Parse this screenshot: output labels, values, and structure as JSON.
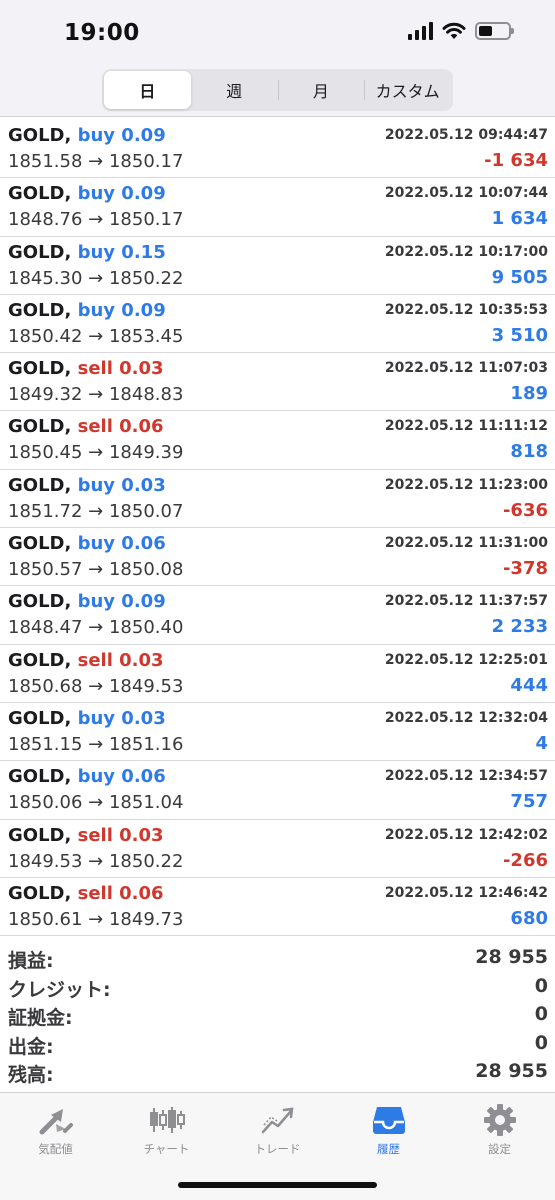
{
  "status_bar": {
    "time": "19:00"
  },
  "segments": [
    {
      "label": "日",
      "active": true
    },
    {
      "label": "週",
      "active": false
    },
    {
      "label": "月",
      "active": false
    },
    {
      "label": "カスタム",
      "active": false
    }
  ],
  "deals": [
    {
      "symbol": "GOLD,",
      "type": "buy",
      "volume": "buy 0.09",
      "prices": "1851.58 → 1850.17",
      "time": "2022.05.12 09:44:47",
      "profit": "-1 634",
      "profit_sign": "neg"
    },
    {
      "symbol": "GOLD,",
      "type": "buy",
      "volume": "buy 0.09",
      "prices": "1848.76 → 1850.17",
      "time": "2022.05.12 10:07:44",
      "profit": "1 634",
      "profit_sign": "pos"
    },
    {
      "symbol": "GOLD,",
      "type": "buy",
      "volume": "buy 0.15",
      "prices": "1845.30 → 1850.22",
      "time": "2022.05.12 10:17:00",
      "profit": "9 505",
      "profit_sign": "pos"
    },
    {
      "symbol": "GOLD,",
      "type": "buy",
      "volume": "buy 0.09",
      "prices": "1850.42 → 1853.45",
      "time": "2022.05.12 10:35:53",
      "profit": "3 510",
      "profit_sign": "pos"
    },
    {
      "symbol": "GOLD,",
      "type": "sell",
      "volume": "sell 0.03",
      "prices": "1849.32 → 1848.83",
      "time": "2022.05.12 11:07:03",
      "profit": "189",
      "profit_sign": "pos"
    },
    {
      "symbol": "GOLD,",
      "type": "sell",
      "volume": "sell 0.06",
      "prices": "1850.45 → 1849.39",
      "time": "2022.05.12 11:11:12",
      "profit": "818",
      "profit_sign": "pos"
    },
    {
      "symbol": "GOLD,",
      "type": "buy",
      "volume": "buy 0.03",
      "prices": "1851.72 → 1850.07",
      "time": "2022.05.12 11:23:00",
      "profit": "-636",
      "profit_sign": "neg"
    },
    {
      "symbol": "GOLD,",
      "type": "buy",
      "volume": "buy 0.06",
      "prices": "1850.57 → 1850.08",
      "time": "2022.05.12 11:31:00",
      "profit": "-378",
      "profit_sign": "neg"
    },
    {
      "symbol": "GOLD,",
      "type": "buy",
      "volume": "buy 0.09",
      "prices": "1848.47 → 1850.40",
      "time": "2022.05.12 11:37:57",
      "profit": "2 233",
      "profit_sign": "pos"
    },
    {
      "symbol": "GOLD,",
      "type": "sell",
      "volume": "sell 0.03",
      "prices": "1850.68 → 1849.53",
      "time": "2022.05.12 12:25:01",
      "profit": "444",
      "profit_sign": "pos"
    },
    {
      "symbol": "GOLD,",
      "type": "buy",
      "volume": "buy 0.03",
      "prices": "1851.15 → 1851.16",
      "time": "2022.05.12 12:32:04",
      "profit": "4",
      "profit_sign": "pos"
    },
    {
      "symbol": "GOLD,",
      "type": "buy",
      "volume": "buy 0.06",
      "prices": "1850.06 → 1851.04",
      "time": "2022.05.12 12:34:57",
      "profit": "757",
      "profit_sign": "pos"
    },
    {
      "symbol": "GOLD,",
      "type": "sell",
      "volume": "sell 0.03",
      "prices": "1849.53 → 1850.22",
      "time": "2022.05.12 12:42:02",
      "profit": "-266",
      "profit_sign": "neg"
    },
    {
      "symbol": "GOLD,",
      "type": "sell",
      "volume": "sell 0.06",
      "prices": "1850.61 → 1849.73",
      "time": "2022.05.12 12:46:42",
      "profit": "680",
      "profit_sign": "pos"
    }
  ],
  "summary": [
    {
      "label": "損益:",
      "value": "28 955"
    },
    {
      "label": "クレジット:",
      "value": "0"
    },
    {
      "label": "証拠金:",
      "value": "0"
    },
    {
      "label": "出金:",
      "value": "0"
    },
    {
      "label": "残高:",
      "value": "28 955"
    }
  ],
  "tabs": [
    {
      "label": "気配値",
      "icon": "quotes-icon",
      "active": false
    },
    {
      "label": "チャート",
      "icon": "chart-icon",
      "active": false
    },
    {
      "label": "トレード",
      "icon": "trade-icon",
      "active": false
    },
    {
      "label": "履歴",
      "icon": "history-icon",
      "active": true
    },
    {
      "label": "設定",
      "icon": "settings-icon",
      "active": false
    }
  ],
  "colors": {
    "buy": "#2f7be5",
    "sell": "#d0382e",
    "positive": "#2f7be5",
    "negative": "#d0382e",
    "active_tab": "#2f7be5",
    "inactive_tab": "#8e8e93"
  }
}
